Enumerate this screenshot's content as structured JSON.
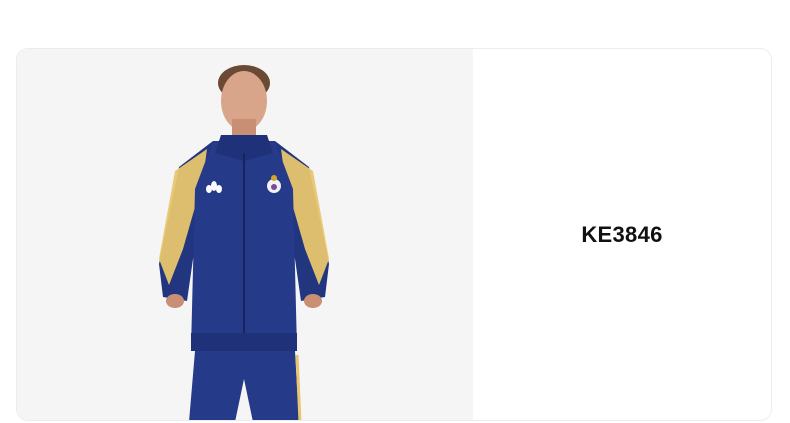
{
  "product": {
    "code": "KE3846",
    "image_alt": "model-wearing-navy-track-jacket"
  },
  "colors": {
    "jacket_navy": "#263a8a",
    "stripe_gold": "#e8c66e",
    "image_background": "#f5f5f5"
  }
}
